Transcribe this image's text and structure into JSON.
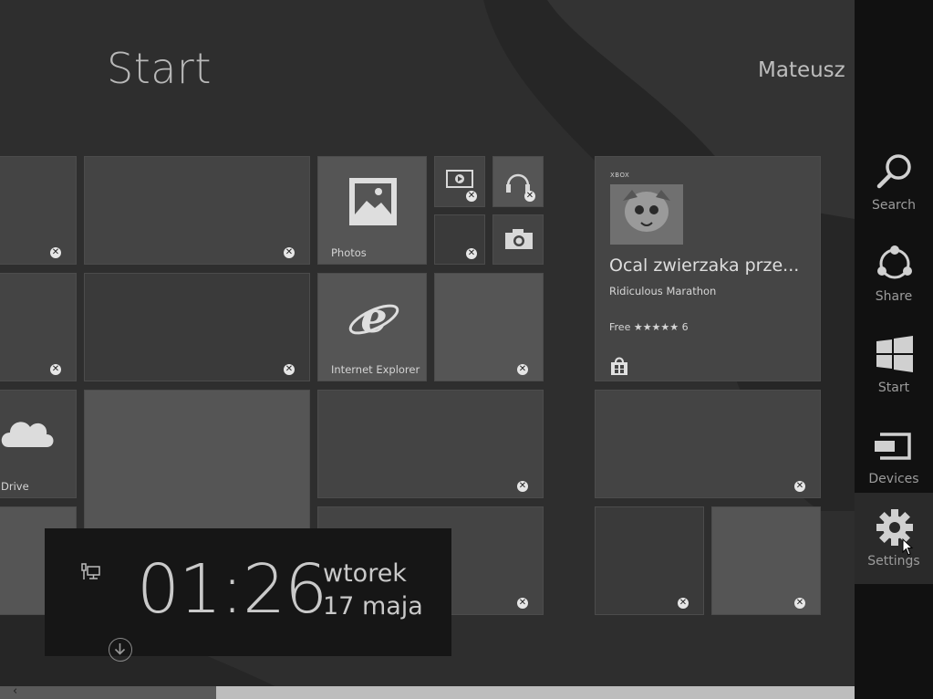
{
  "header": {
    "title": "Start",
    "user": "Mateusz"
  },
  "tiles": {
    "photos": "Photos",
    "internet_explorer": "Internet Explorer",
    "onedrive": "Drive"
  },
  "store_tile": {
    "brand": "XBOX",
    "title": "Ocal zwierzaka prze...",
    "subtitle": "Ridiculous Marathon",
    "price": "Free ★★★★★ 6"
  },
  "clock": {
    "time": "01:26",
    "day": "wtorek",
    "date": "17 maja"
  },
  "charms": [
    {
      "label": "Search",
      "icon": "search-icon"
    },
    {
      "label": "Share",
      "icon": "share-icon"
    },
    {
      "label": "Start",
      "icon": "windows-logo-icon"
    },
    {
      "label": "Devices",
      "icon": "devices-icon"
    },
    {
      "label": "Settings",
      "icon": "gear-icon"
    }
  ],
  "scrollbar": {
    "left_arrow": "‹"
  },
  "colors": {
    "background": "#2e2e2e",
    "tile": "#444444",
    "charms_bar": "#111111",
    "clock_bg": "#161616"
  }
}
